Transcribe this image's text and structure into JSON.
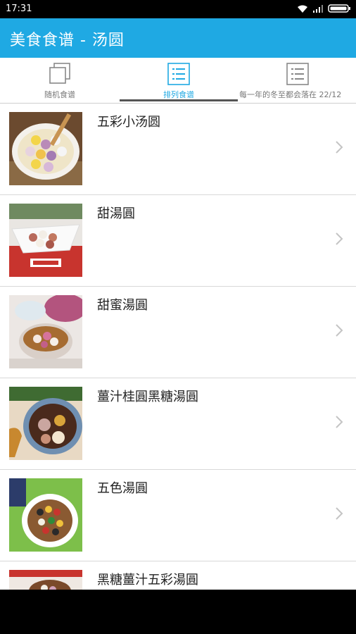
{
  "status_bar": {
    "time": "17:31"
  },
  "app_bar": {
    "title": "美食食谱 - 汤圆"
  },
  "tabs": [
    {
      "label": "随机食谱",
      "icon": "copy-icon",
      "active": false
    },
    {
      "label": "排列食谱",
      "icon": "list-icon",
      "active": true
    },
    {
      "label": "每一年的冬至都会落在 22/12",
      "icon": "list-icon",
      "active": false
    }
  ],
  "recipes": [
    {
      "name": "五彩小汤圆"
    },
    {
      "name": "甜湯圓"
    },
    {
      "name": "甜蜜湯圓"
    },
    {
      "name": "薑汁桂圓黑糖湯圓"
    },
    {
      "name": "五色湯圓"
    },
    {
      "name": "黑糖薑汁五彩湯圓"
    }
  ],
  "colors": {
    "accent": "#1FA9E3",
    "statusbar": "#000000"
  }
}
